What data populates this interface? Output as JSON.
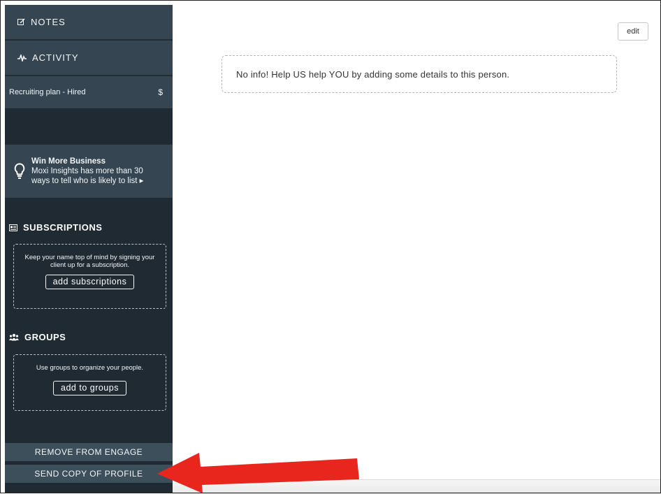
{
  "sidebar": {
    "notes_label": "NOTES",
    "activity_label": "ACTIVITY",
    "recruiting_plan": {
      "label": "Recruiting plan - Hired",
      "badge": "$"
    },
    "promo": {
      "title": "Win More Business",
      "text": "Moxi Insights has more than 30 ways to tell who is likely to list ▸"
    },
    "subscriptions": {
      "heading": "SUBSCRIPTIONS",
      "text": "Keep your name top of mind by signing your client up for a subscription.",
      "button": "add subscriptions"
    },
    "groups": {
      "heading": "GROUPS",
      "text": "Use groups to organize your people.",
      "button": "add to groups"
    },
    "remove_label": "REMOVE FROM ENGAGE",
    "send_copy_label": "SEND COPY OF PROFILE"
  },
  "main": {
    "edit_label": "edit",
    "info_message": "No info! Help US help YOU by adding some details to this person."
  },
  "colors": {
    "sidebar_bg": "#1f2a32",
    "panel_bg": "#354652",
    "button_bg": "#3d4f5b",
    "arrow": "#e8261d"
  },
  "icons": {
    "notes": "edit-note-icon",
    "activity": "activity-pulse-icon",
    "promo": "lightbulb-icon",
    "subscriptions": "newspaper-icon",
    "groups": "people-group-icon"
  }
}
